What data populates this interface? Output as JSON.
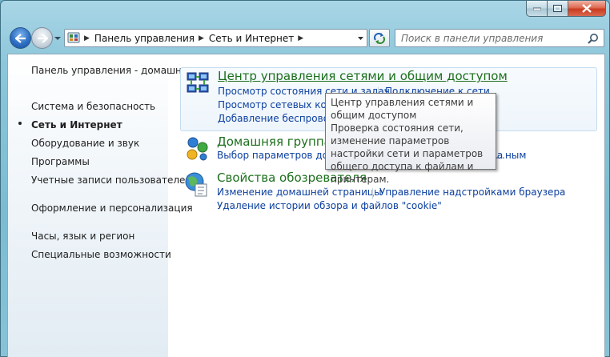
{
  "window": {
    "caption_buttons": [
      "minimize",
      "maximize",
      "close"
    ]
  },
  "navigation": {
    "breadcrumb": [
      "Панель управления",
      "Сеть и Интернет"
    ],
    "search_placeholder": "Поиск в панели управления"
  },
  "sidebar": {
    "items": [
      {
        "label": "Панель управления - домашняя страница",
        "current": false
      },
      {
        "label": "Система и безопасность",
        "current": false
      },
      {
        "label": "Сеть и Интернет",
        "current": true
      },
      {
        "label": "Оборудование и звук",
        "current": false
      },
      {
        "label": "Программы",
        "current": false
      },
      {
        "label": "Учетные записи пользователей",
        "current": false
      },
      {
        "label": "Оформление и персонализация",
        "current": false
      },
      {
        "label": "Часы, язык и регион",
        "current": false
      },
      {
        "label": "Специальные возможности",
        "current": false
      }
    ]
  },
  "categories": [
    {
      "title": "Центр управления сетями и общим доступом",
      "icon": "network-center-icon",
      "tasks": [
        "Просмотр состояния сети и задач",
        "Подключение к сети",
        "Просмотр сетевых компьютеров и устройств",
        "Добавление беспроводного устройства в сеть"
      ]
    },
    {
      "title": "Домашняя группа",
      "icon": "homegroup-icon",
      "tasks": [
        "Выбор параметров домашней группы и общего доступа",
        "…ным"
      ]
    },
    {
      "title": "Свойства обозревателя",
      "icon": "internet-options-icon",
      "tasks": [
        "Изменение домашней страницы",
        "Управление надстройками браузера",
        "Удаление истории обзора и файлов \"cookie\""
      ]
    }
  ],
  "tooltip": {
    "title": "Центр управления сетями и общим доступом",
    "body": "Проверка состояния сети, изменение параметров настройки сети и параметров общего доступа к файлам и принтерам."
  },
  "colors": {
    "category_title": "#1c6f1c",
    "task_link": "#0b3f9e",
    "frame": "#7bbcd2"
  }
}
